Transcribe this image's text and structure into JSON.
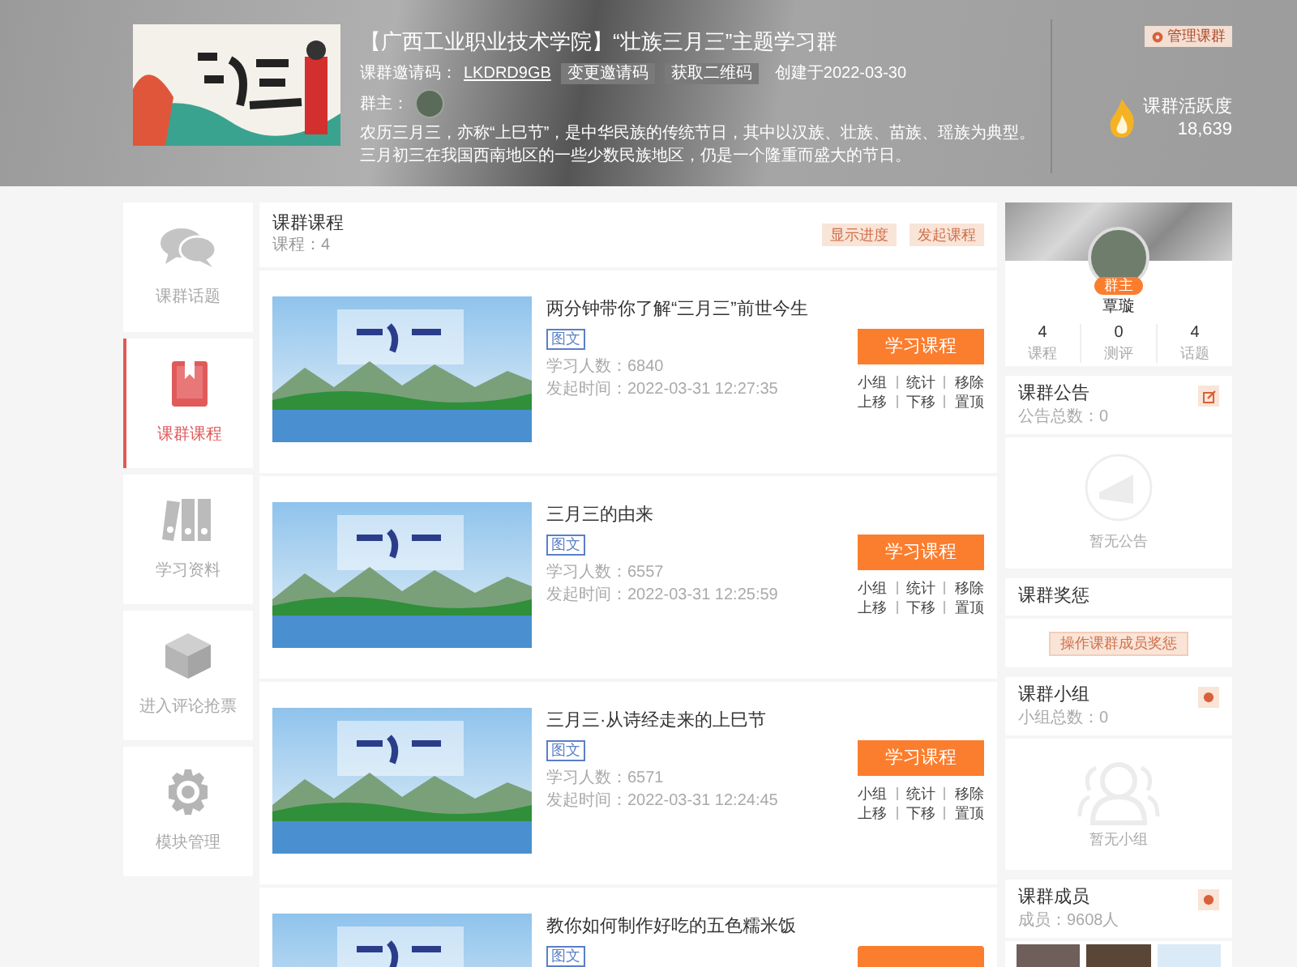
{
  "header": {
    "title": "【广西工业职业技术学院】“壮族三月三”主题学习群",
    "invite_label": "课群邀请码：",
    "invite_code": "LKDRD9GB",
    "buttons": [
      "变更邀请码",
      "获取二维码"
    ],
    "created": "创建于2022-03-30",
    "owner_label": "群主：",
    "description": "农历三月三，亦称“上巳节”，是中华民族的传统节日，其中以汉族、壮族、苗族、瑶族为典型。三月初三在我国西南地区的一些少数民族地区，仍是一个隆重而盛大的节日。",
    "manage_button": "管理课群",
    "activity_label": "课群活跃度",
    "activity_value": "18,639"
  },
  "nav": [
    {
      "label": "课群话题",
      "kind": "chat",
      "selected": false
    },
    {
      "label": "课群课程",
      "kind": "book",
      "selected": true
    },
    {
      "label": "学习资料",
      "kind": "binders",
      "selected": false
    },
    {
      "label": "进入评论抢票",
      "kind": "cube",
      "selected": false
    },
    {
      "label": "模块管理",
      "kind": "gear",
      "selected": false
    }
  ],
  "courses_panel": {
    "title": "课群课程",
    "count": "课程：4",
    "buttons": [
      "显示进度",
      "发起课程"
    ]
  },
  "courses": [
    {
      "title": "两分钟带你了解“三月三”前世今生",
      "tag": "图文",
      "learners": "学习人数：6840",
      "time": "发起时间：2022-03-31 12:27:35",
      "button": "学习课程",
      "actions": [
        "小组",
        "统计",
        "移除",
        "上移",
        "下移",
        "置顶"
      ]
    },
    {
      "title": "三月三的由来",
      "tag": "图文",
      "learners": "学习人数：6557",
      "time": "发起时间：2022-03-31 12:25:59",
      "button": "学习课程",
      "actions": [
        "小组",
        "统计",
        "移除",
        "上移",
        "下移",
        "置顶"
      ]
    },
    {
      "title": "三月三·从诗经走来的上巳节",
      "tag": "图文",
      "learners": "学习人数：6571",
      "time": "发起时间：2022-03-31 12:24:45",
      "button": "学习课程",
      "actions": [
        "小组",
        "统计",
        "移除",
        "上移",
        "下移",
        "置顶"
      ]
    },
    {
      "title": "教你如何制作好吃的五色糯米饭",
      "tag": "图文"
    }
  ],
  "profile": {
    "badge": "群主",
    "name": "覃璇",
    "stats": [
      {
        "value": "4",
        "label": "课程"
      },
      {
        "value": "0",
        "label": "测评"
      },
      {
        "value": "4",
        "label": "话题"
      }
    ]
  },
  "announcement": {
    "title": "课群公告",
    "count": "公告总数：0",
    "empty": "暂无公告"
  },
  "awards": {
    "title": "课群奖惩",
    "button": "操作课群成员奖惩"
  },
  "groups": {
    "title": "课群小组",
    "count": "小组总数：0",
    "empty": "暂无小组"
  },
  "members": {
    "title": "课群成员",
    "count": "成员：9608人"
  }
}
